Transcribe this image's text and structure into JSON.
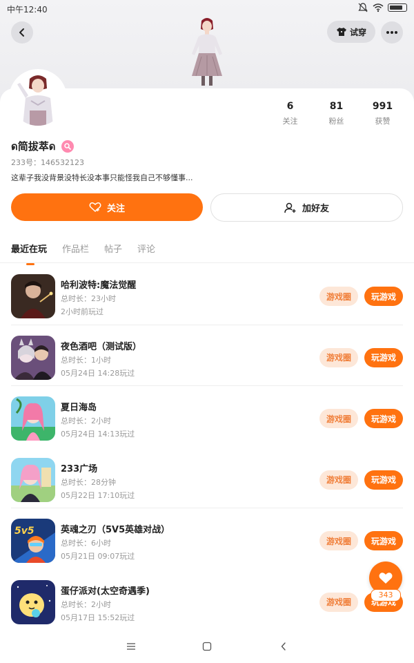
{
  "status_bar": {
    "time": "中午12:40"
  },
  "header": {
    "tryon_label": "试穿"
  },
  "profile": {
    "name_prefix": "ด",
    "name": "简拔萃",
    "name_suffix": "ด",
    "id_text": "233号：146532123",
    "bio": "这辈子我没背景没特长没本事只能怪我自己不够懂事...",
    "stats": [
      {
        "num": "6",
        "label": "关注"
      },
      {
        "num": "81",
        "label": "粉丝"
      },
      {
        "num": "991",
        "label": "获赞"
      }
    ]
  },
  "actions": {
    "follow_label": "关注",
    "add_friend_label": "加好友"
  },
  "tabs": [
    "最近在玩",
    "作品栏",
    "帖子",
    "评论"
  ],
  "games": [
    {
      "name": "哈利波特:魔法觉醒",
      "duration": "总时长：23小时",
      "last": "2小时前玩过"
    },
    {
      "name": "夜色酒吧（测试版）",
      "duration": "总时长：1小时",
      "last": "05月24日 14:28玩过"
    },
    {
      "name": "夏日海岛",
      "duration": "总时长：2小时",
      "last": "05月24日 14:13玩过"
    },
    {
      "name": "233广场",
      "duration": "总时长：28分钟",
      "last": "05月22日 17:10玩过"
    },
    {
      "name": "英魂之刃（5V5英雄对战）",
      "duration": "总时长：6小时",
      "last": "05月21日 09:07玩过"
    },
    {
      "name": "蛋仔派对(太空奇遇季)",
      "duration": "总时长：2小时",
      "last": "05月17日 15:52玩过"
    }
  ],
  "game_buttons": {
    "circle": "游戏圈",
    "play": "玩游戏"
  },
  "fab": {
    "count": "343"
  },
  "colors": {
    "accent": "#ff7210",
    "circle_bg": "#fde7d8",
    "circle_text": "#f07f3a"
  },
  "icons": [
    "back-arrow-icon",
    "shirt-icon",
    "more-dots-icon",
    "heart-plus-icon",
    "add-user-icon",
    "heart-icon",
    "menu-icon",
    "square-icon",
    "back-chevron-icon"
  ]
}
